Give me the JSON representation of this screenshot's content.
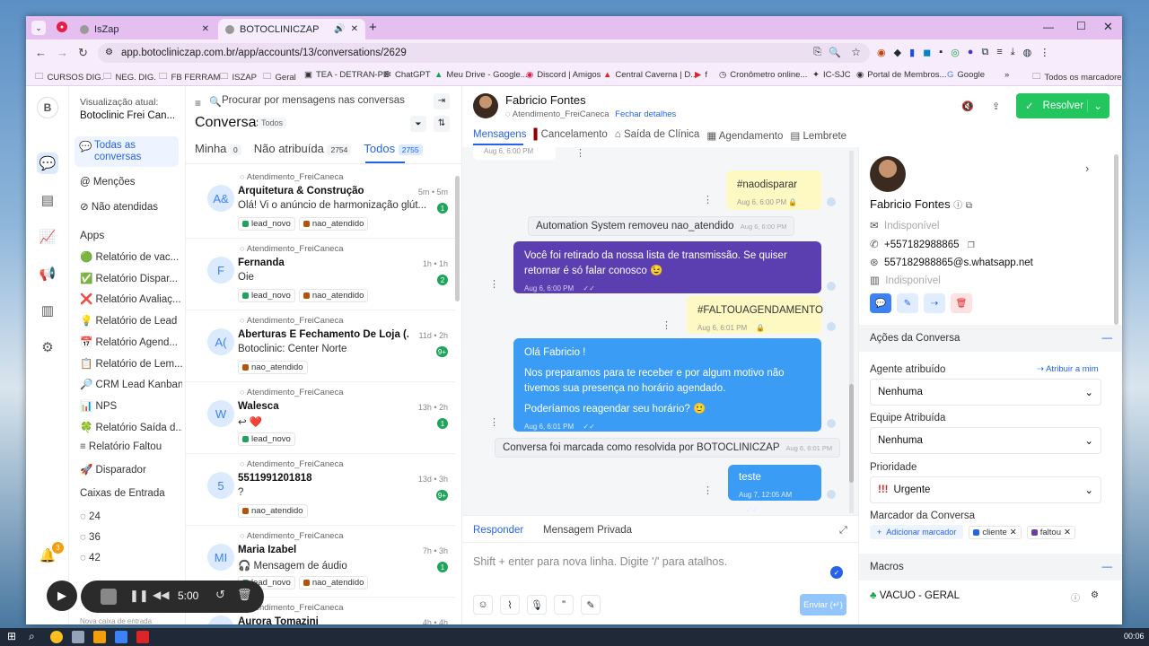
{
  "browser": {
    "tabs": [
      {
        "label": "IsZap"
      },
      {
        "label": "BOTOCLINICZAP"
      }
    ],
    "url": "app.botocliniczap.com.br/app/accounts/13/conversations/2629",
    "bookmarks": [
      "CURSOS DIG.",
      "NEG. DIG.",
      "FB FERRAM",
      "ISZAP",
      "Geral",
      "TEA - DETRAN-PE",
      "ChatGPT",
      "Meu Drive - Google...",
      "Discord | Amigos",
      "Central Caverna | D...",
      "f",
      "Cronômetro online...",
      "IC-SJC",
      "Portal de Membros...",
      "Google"
    ],
    "all_bookmarks": "Todos os marcadores"
  },
  "sidebar": {
    "view_label": "Visualização atual:",
    "view_value": "Botoclinic Frei Can...",
    "nav": [
      "Todas as conversas",
      "Menções",
      "Não atendidas"
    ],
    "apps_title": "Apps",
    "apps": [
      {
        "icon": "🟢",
        "label": "Relatório de vac..."
      },
      {
        "icon": "✅",
        "label": "Relatório Dispar..."
      },
      {
        "icon": "❌",
        "label": "Relatório Avaliaç..."
      },
      {
        "icon": "💡",
        "label": "Relatório de Lead"
      },
      {
        "icon": "📅",
        "label": "Relatório Agend..."
      },
      {
        "icon": "📋",
        "label": "Relatório de Lem..."
      },
      {
        "icon": "🔎",
        "label": "CRM Lead Kanban"
      },
      {
        "icon": "📊",
        "label": "NPS"
      },
      {
        "icon": "🍀",
        "label": "Relatório Saída d..."
      },
      {
        "icon": "≡",
        "label": "Relatório Faltou"
      },
      {
        "icon": "🚀",
        "label": "Disparador"
      }
    ],
    "inboxes_title": "Caixas de Entrada",
    "inboxes": [
      "24",
      "36",
      "42"
    ],
    "notif_count": "3",
    "new_inbox": "Nova caixa de entrada"
  },
  "conversations": {
    "search_placeholder": "Procurar por mensagens nas conversas",
    "title": "Conversas",
    "filter_badge": "Todos",
    "tabs": [
      {
        "label": "Minha",
        "count": "0"
      },
      {
        "label": "Não atribuída",
        "count": "2754"
      },
      {
        "label": "Todos",
        "count": "2755"
      }
    ],
    "items": [
      {
        "initials": "A&",
        "inbox": "Atendimento_FreiCaneca",
        "name": "Arquitetura & Construção",
        "message": "Olá! Vi o anúncio de harmonização glút...",
        "time": "5m • 5m",
        "badge": "1",
        "labels": [
          {
            "name": "lead_novo",
            "color": "#22a35a"
          },
          {
            "name": "nao_atendido",
            "color": "#b45309"
          }
        ]
      },
      {
        "initials": "F",
        "inbox": "Atendimento_FreiCaneca",
        "name": "Fernanda",
        "message": "Oie",
        "time": "1h • 1h",
        "badge": "2",
        "labels": [
          {
            "name": "lead_novo",
            "color": "#22a35a"
          },
          {
            "name": "nao_atendido",
            "color": "#b45309"
          }
        ]
      },
      {
        "initials": "A(",
        "inbox": "Atendimento_FreiCaneca",
        "name": "Aberturas E Fechamento De Loja (...",
        "message": "Botoclinic: Center Norte",
        "time": "11d • 2h",
        "badge": "9+",
        "labels": [
          {
            "name": "nao_atendido",
            "color": "#b45309"
          }
        ]
      },
      {
        "initials": "W",
        "inbox": "Atendimento_FreiCaneca",
        "name": "Walesca",
        "message": "↩ ❤️",
        "time": "13h • 2h",
        "badge": "1",
        "labels": [
          {
            "name": "lead_novo",
            "color": "#22a35a"
          }
        ]
      },
      {
        "initials": "5",
        "inbox": "Atendimento_FreiCaneca",
        "name": "5511991201818",
        "message": "?",
        "time": "13d • 3h",
        "badge": "9+",
        "labels": [
          {
            "name": "nao_atendido",
            "color": "#b45309"
          }
        ]
      },
      {
        "initials": "MI",
        "inbox": "Atendimento_FreiCaneca",
        "name": "Maria Izabel",
        "message": "🎧 Mensagem de áudio",
        "time": "7h • 3h",
        "badge": "1",
        "labels": [
          {
            "name": "lead_novo",
            "color": "#22a35a"
          },
          {
            "name": "nao_atendido",
            "color": "#b45309"
          }
        ]
      },
      {
        "initials": "AT",
        "inbox": "Atendimento_FreiCaneca",
        "name": "Aurora Tomazini",
        "message": "",
        "time": "4h • 4h",
        "badge": "",
        "labels": []
      }
    ]
  },
  "chat": {
    "contact_name": "Fabricio Fontes",
    "inbox": "Atendimento_FreiCaneca",
    "close_details": "Fechar detalhes",
    "resolve_label": "Resolver",
    "tabs": [
      "Mensagens",
      "Cancelamento",
      "Saída de Clínica",
      "Agendamento",
      "Lembrete"
    ],
    "messages": [
      {
        "type": "note_time",
        "time": "Aug 6, 6:00 PM"
      },
      {
        "type": "private",
        "text": "#naodisparar",
        "time": "Aug 6, 6:00 PM"
      },
      {
        "type": "activity",
        "text": "Automation System removeu nao_atendido",
        "time": "Aug 6, 6:00 PM"
      },
      {
        "type": "outgoing_purple",
        "text": "Você foi retirado da nossa lista de transmissão. Se quiser retornar é só falar conosco 😉",
        "time": "Aug 6, 6:00 PM"
      },
      {
        "type": "private",
        "text": "#FALTOUAGENDAMENTO",
        "time": "Aug 6, 6:01 PM"
      },
      {
        "type": "outgoing_blue",
        "lines": [
          "Olá Fabricio !",
          "Nos preparamos para te receber e por algum motivo não tivemos sua presença no horário agendado.",
          "Poderíamos reagendar seu horário? 🙂"
        ],
        "time": "Aug 6, 6:01 PM"
      },
      {
        "type": "activity",
        "text": "Conversa foi marcada como resolvida por BOTOCLINICZAP",
        "time": "Aug 6, 6:01 PM"
      },
      {
        "type": "outgoing_blue",
        "text": "teste",
        "time": "Aug 7, 12:05 AM"
      }
    ],
    "reply_tabs": [
      "Responder",
      "Mensagem Privada"
    ],
    "reply_placeholder": "Shift + enter para nova linha. Digite '/' para atalhos.",
    "send_label": "Enviar (↵)"
  },
  "details": {
    "name": "Fabricio Fontes",
    "email": "Indisponível",
    "phone": "+557182988865",
    "whatsapp": "557182988865@s.whatsapp.net",
    "company": "Indisponível",
    "actions_title": "Ações da Conversa",
    "agent_label": "Agente atribuído",
    "assign_me": "Atribuir a mim",
    "agent_value": "Nenhuma",
    "team_label": "Equipe Atribuída",
    "team_value": "Nenhuma",
    "priority_label": "Prioridade",
    "priority_value": "Urgente",
    "labels_title": "Marcador da Conversa",
    "add_label": "Adicionar marcador",
    "labels": [
      {
        "name": "cliente",
        "color": "#2563eb"
      },
      {
        "name": "faltou",
        "color": "#6b3fa0"
      }
    ],
    "macros_title": "Macros",
    "macros": [
      "VACUO - GERAL"
    ]
  },
  "recorder": {
    "time": "5:00"
  },
  "taskbar": {
    "clock": "00:06"
  }
}
